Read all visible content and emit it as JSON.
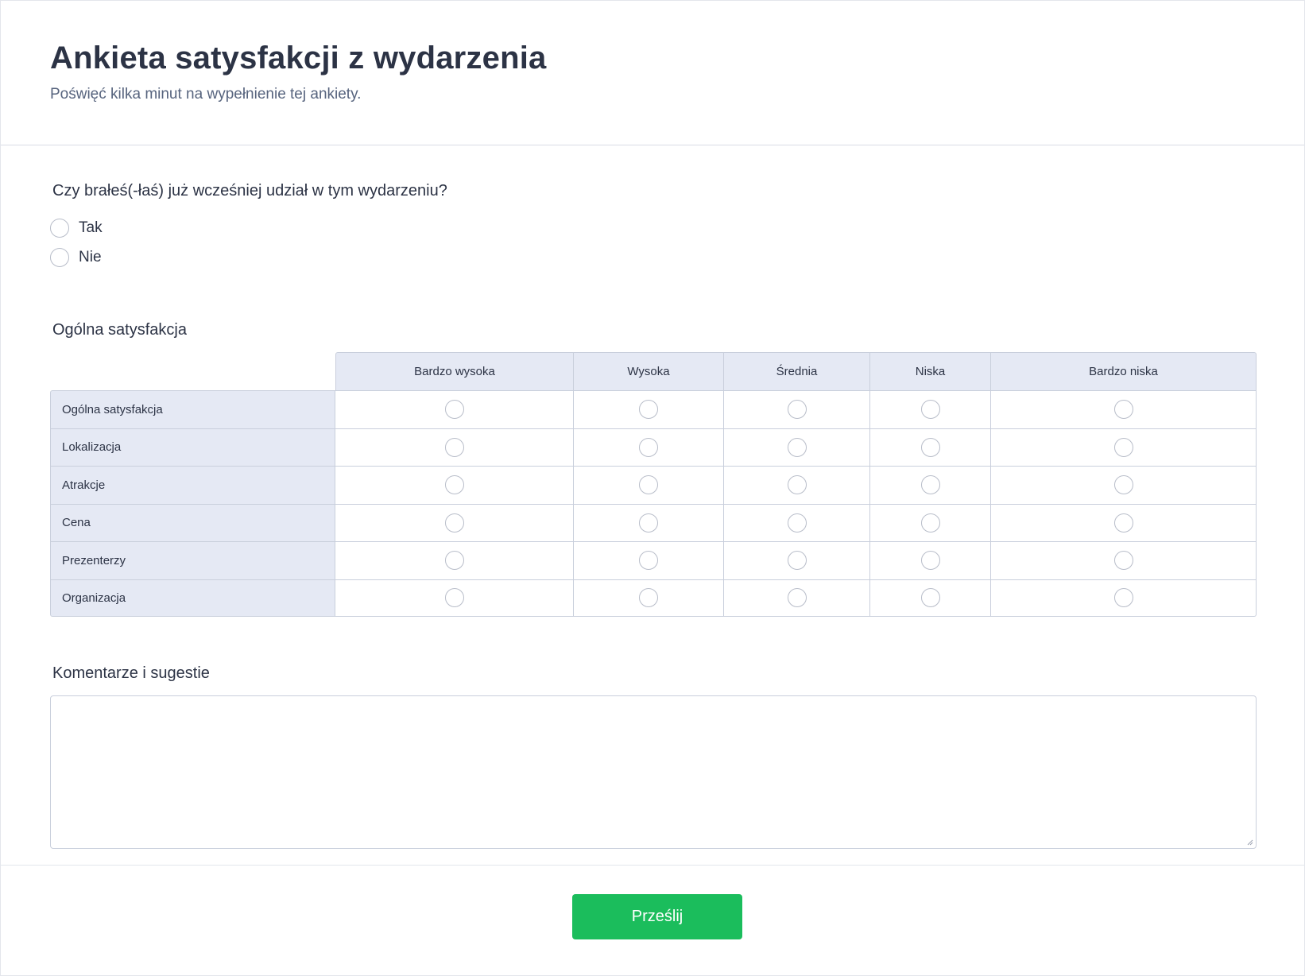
{
  "header": {
    "title": "Ankieta satysfakcji z wydarzenia",
    "subtitle": "Poświęć kilka minut na wypełnienie tej ankiety."
  },
  "question1": {
    "label": "Czy brałeś(-łaś) już wcześniej udział w tym wydarzeniu?",
    "options": [
      "Tak",
      "Nie"
    ]
  },
  "matrix": {
    "label": "Ogólna satysfakcja",
    "columns": [
      "Bardzo wysoka",
      "Wysoka",
      "Średnia",
      "Niska",
      "Bardzo niska"
    ],
    "rows": [
      "Ogólna satysfakcja",
      "Lokalizacja",
      "Atrakcje",
      "Cena",
      "Prezenterzy",
      "Organizacja"
    ]
  },
  "comments": {
    "label": "Komentarze i sugestie",
    "value": ""
  },
  "footer": {
    "submit_label": "Prześlij"
  },
  "colors": {
    "accent": "#1bbd5c",
    "matrix_header_bg": "#e5e9f4",
    "text": "#2c3345"
  }
}
